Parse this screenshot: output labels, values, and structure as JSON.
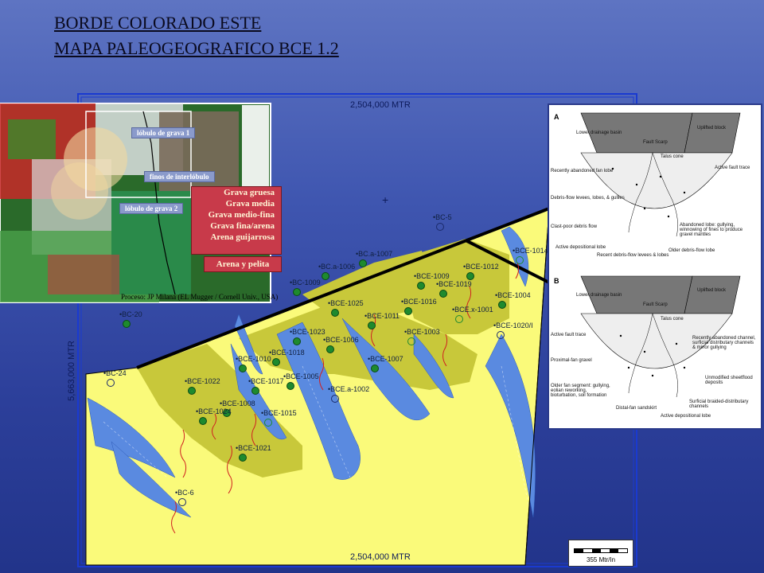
{
  "title": {
    "line1": "BORDE  COLORADO  ESTE",
    "line2": "MAPA PALEOGEOGRAFICO BCE 1.2"
  },
  "coords": {
    "top": "2,504,000 MTR",
    "bottom": "2,504,000 MTR",
    "left": "5,663,000 MTR"
  },
  "legend": {
    "items": [
      "Grava gruesa",
      "Grava media",
      "Grava medio-fina",
      "Grava fina/arena",
      "Arena guijarrosa"
    ],
    "extra": "Arena y pelita"
  },
  "inset": {
    "lobes": [
      "lóbulo de grava 1",
      "finos de interlóbulo",
      "lóbulo de grava 2"
    ],
    "credit": "Proceso: JP Milana (EL Mugger / Cornell Univ., USA)"
  },
  "wells": [
    {
      "label": "BC-5",
      "type": "open"
    },
    {
      "label": "BCE-1014",
      "type": "dry"
    },
    {
      "label": "BC.a-1007",
      "type": "filled"
    },
    {
      "label": "BC.a-1006",
      "type": "filled"
    },
    {
      "label": "BCE-1012",
      "type": "filled"
    },
    {
      "label": "BC-1009",
      "type": "filled"
    },
    {
      "label": "BCE-1009",
      "type": "filled"
    },
    {
      "label": "BCE-1019",
      "type": "filled"
    },
    {
      "label": "BCE-1004",
      "type": "filled"
    },
    {
      "label": "BCE-1025",
      "type": "filled"
    },
    {
      "label": "BCE-1016",
      "type": "filled"
    },
    {
      "label": "BCE.x-1001",
      "type": "dry"
    },
    {
      "label": "BC-20",
      "type": "filled"
    },
    {
      "label": "BCE-1011",
      "type": "filled"
    },
    {
      "label": "BCE-1020/I",
      "type": "open"
    },
    {
      "label": "BCE-1003",
      "type": "dry"
    },
    {
      "label": "BCE-1023",
      "type": "filled"
    },
    {
      "label": "BCE-1006",
      "type": "filled"
    },
    {
      "label": "BCE-1018",
      "type": "filled"
    },
    {
      "label": "BCE-1010",
      "type": "filled"
    },
    {
      "label": "BCE-1007",
      "type": "filled"
    },
    {
      "label": "BC-24",
      "type": "open"
    },
    {
      "label": "BCE-1005",
      "type": "filled"
    },
    {
      "label": "BCE-1022",
      "type": "filled"
    },
    {
      "label": "BCE-1017",
      "type": "filled"
    },
    {
      "label": "BCE.a-1002",
      "type": "open"
    },
    {
      "label": "BCE-1008",
      "type": "filled"
    },
    {
      "label": "BCE-1024",
      "type": "filled"
    },
    {
      "label": "BCE-1015",
      "type": "dry"
    },
    {
      "label": "BCE-1021",
      "type": "filled"
    },
    {
      "label": "BC-6",
      "type": "open"
    }
  ],
  "scale": "355 Mtr/In",
  "diagram": {
    "panelA": "A",
    "panelB": "B",
    "labelsA": [
      "Lower drainage basin",
      "Uplifted block",
      "Fault Scarp",
      "Talus cone",
      "Active fault trace",
      "Recently abandoned fan lobe",
      "Debris-flow levees, lobes, & gullies",
      "Clast-poor debris flow",
      "Active depositional lobe",
      "Recent debris-flow levees & lobes",
      "Older debris-flow lobe",
      "Abandoned lobe: gullying, winnowing of fines to produce gravel mantles"
    ],
    "labelsB": [
      "Lower drainage basin",
      "Uplifted block",
      "Fault Scarp",
      "Talus cone",
      "Active fault trace",
      "Recently abandoned channel, surficial distributary channels & minor gullying",
      "Proximal-fan gravel",
      "Older fan segment: gullying, eolian reworking, bioturbation, soil formation",
      "Unmodified sheetflood deposits",
      "Distal-fan sandskirt",
      "Active depositional lobe",
      "Surficial braided-distributary channels"
    ]
  },
  "colors": {
    "sand": "#fafa7a",
    "gravel": "#c8c83a",
    "channel": "#5a8ae0",
    "well": "#1e8a2e"
  }
}
